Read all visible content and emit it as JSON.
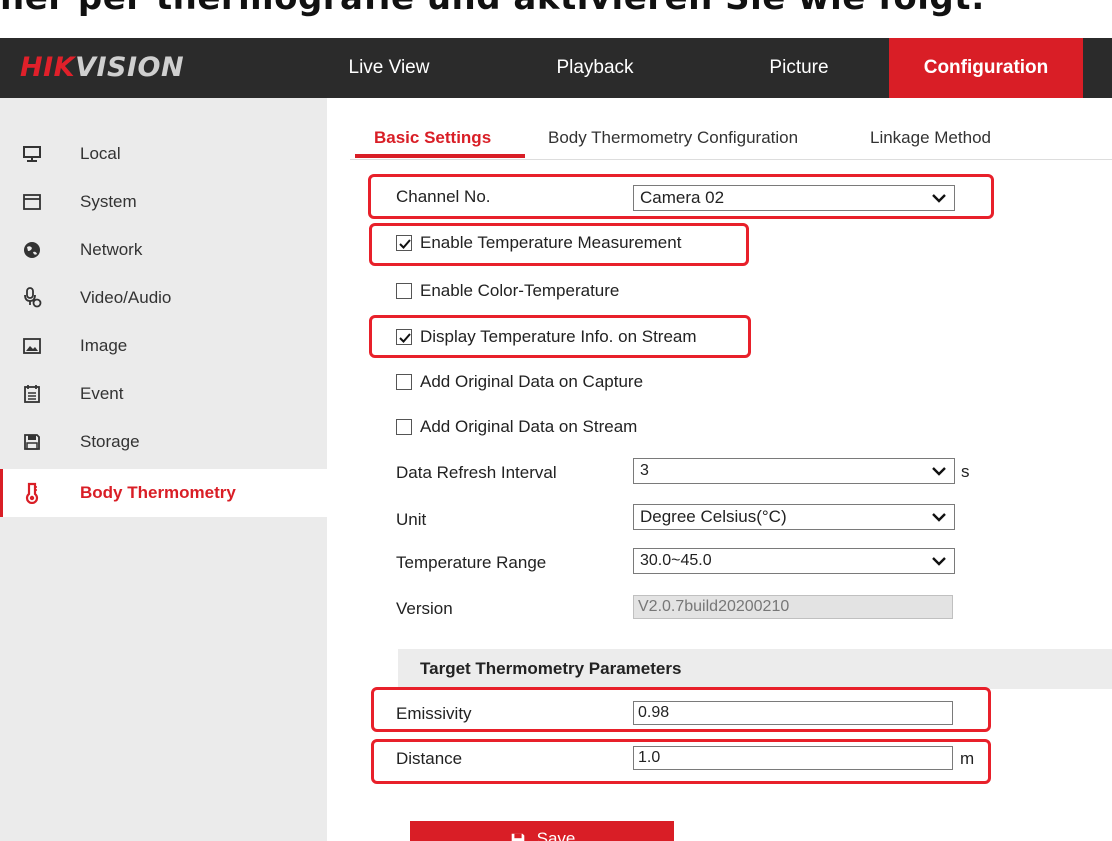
{
  "caption": "ner per thermografie und aktivieren Sie wie folgt:",
  "header": {
    "logo_hik": "HIK",
    "logo_vision": "VISION",
    "nav": [
      {
        "label": "Live View"
      },
      {
        "label": "Playback"
      },
      {
        "label": "Picture"
      },
      {
        "label": "Configuration",
        "active": true
      }
    ]
  },
  "sidebar": {
    "items": [
      {
        "label": "Local",
        "icon": "monitor-icon"
      },
      {
        "label": "System",
        "icon": "window-icon"
      },
      {
        "label": "Network",
        "icon": "globe-icon"
      },
      {
        "label": "Video/Audio",
        "icon": "microphone-icon"
      },
      {
        "label": "Image",
        "icon": "image-icon"
      },
      {
        "label": "Event",
        "icon": "calendar-icon"
      },
      {
        "label": "Storage",
        "icon": "floppy-icon"
      },
      {
        "label": "Body Thermometry",
        "icon": "thermometer-icon",
        "active": true
      }
    ]
  },
  "tabs": [
    {
      "label": "Basic Settings",
      "active": true
    },
    {
      "label": "Body Thermometry Configuration"
    },
    {
      "label": "Linkage Method"
    }
  ],
  "form": {
    "channel": {
      "label": "Channel No.",
      "value": "Camera 02"
    },
    "checkboxes": [
      {
        "label": "Enable Temperature Measurement",
        "checked": true
      },
      {
        "label": "Enable Color-Temperature",
        "checked": false
      },
      {
        "label": "Display Temperature Info. on Stream",
        "checked": true
      },
      {
        "label": "Add Original Data on Capture",
        "checked": false
      },
      {
        "label": "Add Original Data on Stream",
        "checked": false
      }
    ],
    "refresh": {
      "label": "Data Refresh Interval",
      "value": "3",
      "unit": "s"
    },
    "unit": {
      "label": "Unit",
      "value": "Degree Celsius(°C)"
    },
    "range": {
      "label": "Temperature Range",
      "value": "30.0~45.0"
    },
    "version": {
      "label": "Version",
      "value": "V2.0.7build20200210"
    },
    "section_title": "Target Thermometry Parameters",
    "emissivity": {
      "label": "Emissivity",
      "value": "0.98"
    },
    "distance": {
      "label": "Distance",
      "value": "1.0",
      "unit": "m"
    }
  },
  "save_label": "Save",
  "colors": {
    "accent": "#d91e26",
    "highlight": "#e8202a",
    "header_bg": "#2b2b2b",
    "sidebar_bg": "#ebebeb"
  }
}
